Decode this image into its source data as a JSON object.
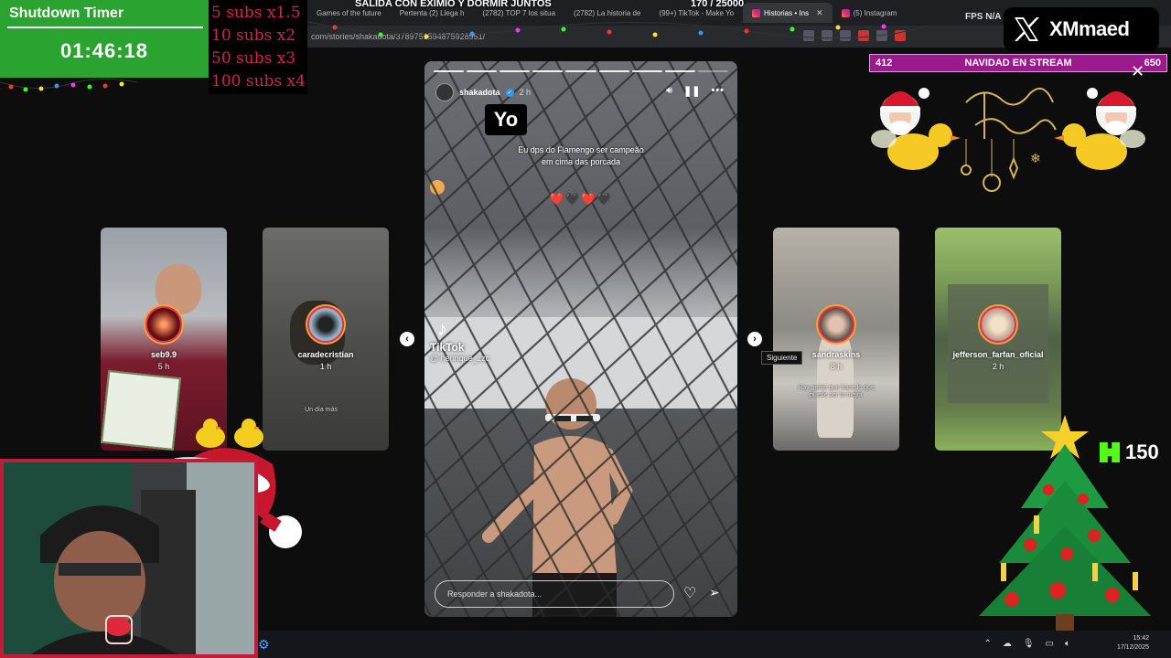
{
  "stream_title": "SALIDA CON EXIMIO Y DORMIR JUNTOS",
  "sub_goal": "170 / 25000",
  "shutdown_timer": {
    "title": "Shutdown Timer",
    "value": "01:46:18"
  },
  "sub_multipliers": [
    "5 subs x1.5",
    "10 subs x2",
    "50 subs x3",
    "100 subs x4"
  ],
  "browser": {
    "tabs": [
      {
        "label": "Games of the future",
        "icon": "tab-icon",
        "active": false
      },
      {
        "label": "Pertenta (2) Llega h",
        "icon": "tab-icon",
        "active": false
      },
      {
        "label": "(2782) TOP 7 los situa",
        "icon": "tab-icon",
        "active": false
      },
      {
        "label": "(2782) La historia de",
        "icon": "tab-icon",
        "active": false
      },
      {
        "label": "(99+) TikTok - Make Yo",
        "icon": "tab-icon",
        "active": false
      },
      {
        "label": "Historias • Ins",
        "icon": "instagram-icon",
        "active": true
      },
      {
        "label": "(5) Instagram",
        "icon": "instagram-icon",
        "active": false
      }
    ],
    "url": "com/stories/shakadota/3789751594875928951/"
  },
  "fps_label": "FPS N/A",
  "x_badge": {
    "name": "XMmaed"
  },
  "navidad_bar": {
    "left": "412",
    "title": "NAVIDAD EN STREAM",
    "right": "650"
  },
  "side_stories": [
    {
      "user": "seb9.9",
      "time": "5 h",
      "note": ""
    },
    {
      "user": "caradecristian",
      "time": "1 h",
      "note": "Un día más"
    },
    {
      "user": "sandraskins",
      "time": "8 h",
      "note": "Hay gente que hace lo que puede ser lo mejor"
    },
    {
      "user": "jefferson_farfan_oficial",
      "time": "2 h",
      "note": ""
    }
  ],
  "tooltip": "Siguiente",
  "story": {
    "user": "shakadota",
    "time": "2 h",
    "sticker": "Yo",
    "caption": "Eu dps do Flamengo ser campeão em cima das porcada",
    "hearts": "❤️🖤❤️🖤",
    "tiktok_word": "TikTok",
    "tiktok_handle": "@ henrique_zzc",
    "reply_placeholder": "Responder a shakadota...",
    "progress": {
      "total_segments": 9,
      "current_segment": 9
    }
  },
  "kick": {
    "count": "150"
  },
  "taskbar": {
    "time": "15:42",
    "date": "17/12/2025"
  },
  "colors": {
    "timer_bg": "#2aa330",
    "subs_text": "#d0235a",
    "navidad_bar": "#9a1a8e",
    "webcam_border": "#c01d3a",
    "kick": "#53fc18"
  }
}
